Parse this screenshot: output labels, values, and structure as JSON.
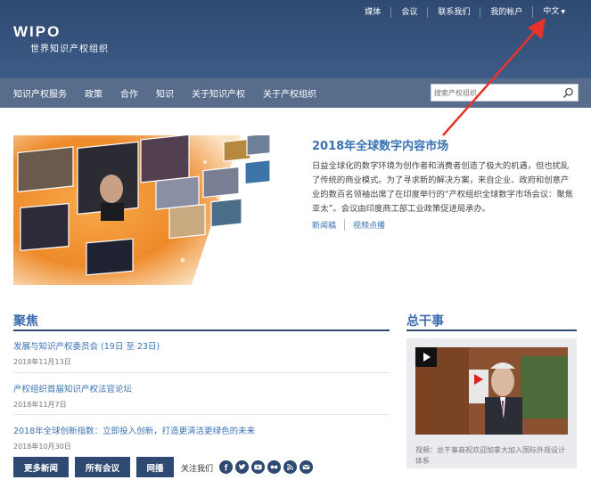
{
  "logo": {
    "name": "WIPO",
    "subtitle": "世界知识产权组织"
  },
  "top_links": [
    "媒体",
    "会议",
    "联系我们",
    "我的帐户"
  ],
  "language": "中文",
  "nav": [
    "知识产权服务",
    "政策",
    "合作",
    "知识",
    "关于知识产权",
    "关于产权组织"
  ],
  "search": {
    "placeholder": "搜索产权组织"
  },
  "hero": {
    "title": "2018年全球数字内容市场",
    "body": "日益全球化的数字环境为创作者和消费者创造了极大的机遇，但也扰乱了传统的商业模式。为了寻求新的解决方案，来自企业、政府和创意产业的数百名领袖出席了在印度举行的“产权组织全球数字市场会议：聚焦亚太”。会议由印度商工部工业政策促进局承办。",
    "links": [
      "新闻稿",
      "视频点播"
    ]
  },
  "focus": {
    "title": "聚焦",
    "items": [
      {
        "title": "发展与知识产权委员会 (19日 至 23日)",
        "date": "2018年11月13日"
      },
      {
        "title": "产权组织首届知识产权法官论坛",
        "date": "2018年11月7日"
      },
      {
        "title": "2018年全球创新指数：立即投入创新，打造更清洁更绿色的未来",
        "date": "2018年10月30日"
      }
    ],
    "buttons": [
      "更多新闻",
      "所有会议",
      "网播"
    ],
    "follow_label": "关注我们",
    "social_icons": [
      "facebook-icon",
      "twitter-icon",
      "youtube-icon",
      "flickr-icon",
      "rss-icon",
      "email-icon"
    ]
  },
  "dg": {
    "title": "总干事",
    "caption": "视频：总干事商祝欢迎加拿大加入国际外观设计体系"
  },
  "colors": {
    "header": "#2f4a72",
    "nav": "#586c8c",
    "link": "#3972b2",
    "annotation_arrow": "#e8332a"
  }
}
